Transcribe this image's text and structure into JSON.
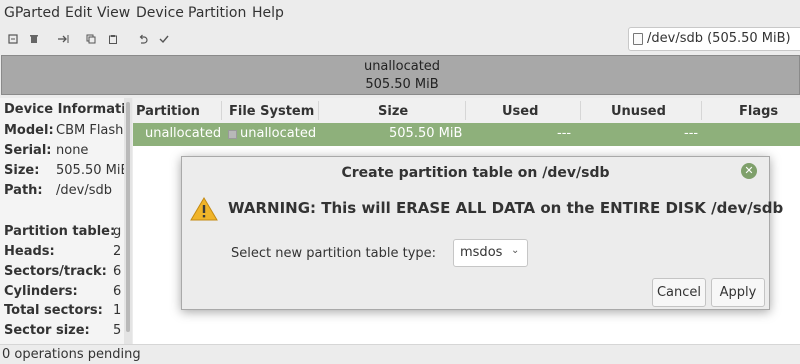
{
  "menubar": {
    "items": [
      "GParted",
      "Edit",
      "View",
      "Device",
      "Partition",
      "Help"
    ]
  },
  "toolbar": {
    "icons": [
      "new-icon",
      "delete-icon",
      "resize-icon",
      "copy-icon",
      "paste-icon",
      "undo-icon",
      "apply-icon"
    ]
  },
  "device_selector": {
    "value": "/dev/sdb  (505.50 MiB)",
    "icon": "disk-icon"
  },
  "disk_bar": {
    "label": "unallocated",
    "size": "505.50 MiB"
  },
  "sidebar": {
    "title": "Device Informati",
    "rows": [
      {
        "key": "Model:",
        "value": "CBM Flash"
      },
      {
        "key": "Serial:",
        "value": "none"
      },
      {
        "key": "Size:",
        "value": "505.50 MiB"
      },
      {
        "key": "Path:",
        "value": "/dev/sdb"
      }
    ],
    "rows2": [
      {
        "key": "Partition table:",
        "value": "g"
      },
      {
        "key": "Heads:",
        "value": "2"
      },
      {
        "key": "Sectors/track:",
        "value": "6"
      },
      {
        "key": "Cylinders:",
        "value": "6"
      },
      {
        "key": "Total sectors:",
        "value": "1"
      },
      {
        "key": "Sector size:",
        "value": "5"
      }
    ]
  },
  "table": {
    "columns": [
      "Partition",
      "File System",
      "Size",
      "Used",
      "Unused",
      "Flags"
    ],
    "rows": [
      {
        "partition": "unallocated",
        "filesystem": "unallocated",
        "size": "505.50 MiB",
        "used": "---",
        "unused": "---",
        "flags": ""
      }
    ]
  },
  "status": {
    "text": "0 operations pending"
  },
  "dialog": {
    "title": "Create partition table on /dev/sdb",
    "warning": "WARNING:  This will ERASE ALL DATA on the ENTIRE DISK /dev/sdb",
    "select_label": "Select new partition table type:",
    "select_value": "msdos",
    "cancel_label": "Cancel",
    "apply_label": "Apply"
  },
  "colors": {
    "selected_row": "#8eb07b",
    "disk_bar": "#a8a8a8",
    "close_button": "#7fa06b",
    "warning": "#f0b429"
  }
}
